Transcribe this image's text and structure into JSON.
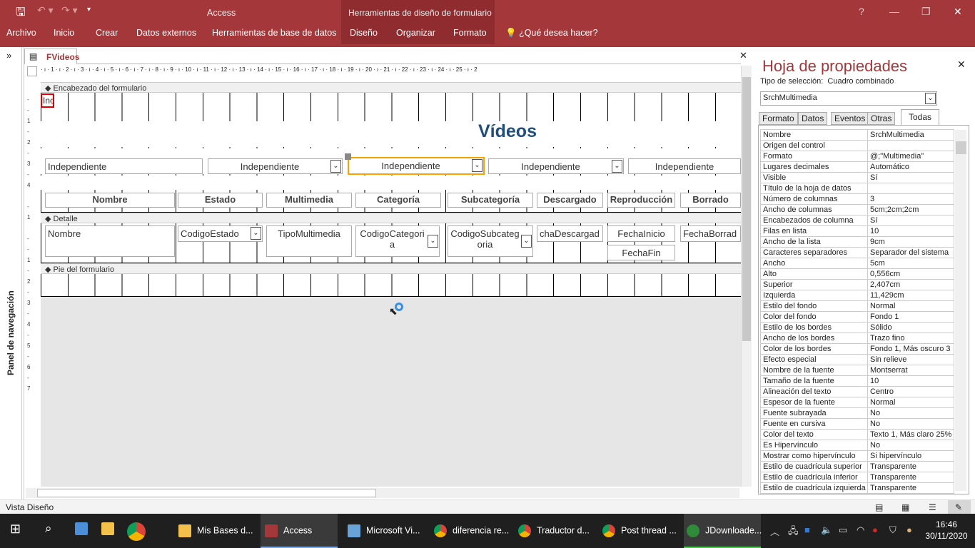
{
  "app": {
    "title": "Access",
    "context_title": "Herramientas de diseño de formulario"
  },
  "ribbon": {
    "tabs": [
      "Archivo",
      "Inicio",
      "Crear",
      "Datos externos",
      "Herramientas de base de datos",
      "Diseño",
      "Organizar",
      "Formato"
    ],
    "tell_me": "¿Qué desea hacer?"
  },
  "nav": {
    "label": "Panel de navegación",
    "expand": "»"
  },
  "document": {
    "tab": "FVideos",
    "ruler": "· ı · 1 · ı · 2 · ı · 3 · ı · 4 · ı · 5 · ı · 6 · ı · 7 · ı · 8 · ı · 9 · ı · 10 · ı · 11 · ı · 12 · ı · 13 · ı · 14 · ı · 15 · ı · 16 · ı · 17 · ı · 18 · ı · 19 · ı · 20 · ı · 21 · ı · 22 · ı · 23 · ı · 24 · ı · 25 · ı · 2"
  },
  "form": {
    "sections": {
      "header": "Encabezado del formulario",
      "detail": "Detalle",
      "footer": "Pie del formulario"
    },
    "header_small": "Inc",
    "title": "Vídeos",
    "header_controls": [
      "Independiente",
      "Independiente",
      "Independiente",
      "Independiente",
      "Independiente"
    ],
    "labels": [
      "Nombre",
      "Estado",
      "Multimedia",
      "Categoría",
      "Subcategoría",
      "Descargado",
      "Reproducción",
      "Borrado"
    ],
    "detail_controls": [
      "Nombre",
      "CodigoEstado",
      "TipoMultimedia",
      "CodigoCategoria",
      "CodigoSubcategoria",
      "chaDescargad",
      "FechaInicio",
      "FechaFin",
      "FechaBorrad"
    ]
  },
  "properties": {
    "title": "Hoja de propiedades",
    "selection_type_label": "Tipo de selección:",
    "selection_type": "Cuadro combinado",
    "object": "SrchMultimedia",
    "tabs": [
      "Formato",
      "Datos",
      "Eventos",
      "Otras",
      "Todas"
    ],
    "active_tab": "Todas",
    "rows": [
      [
        "Nombre",
        "SrchMultimedia"
      ],
      [
        "Origen del control",
        ""
      ],
      [
        "Formato",
        "@;\"Multimedia\""
      ],
      [
        "Lugares decimales",
        "Automático"
      ],
      [
        "Visible",
        "Sí"
      ],
      [
        "Título de la hoja de datos",
        ""
      ],
      [
        "Número de columnas",
        "3"
      ],
      [
        "Ancho de columnas",
        "5cm;2cm;2cm"
      ],
      [
        "Encabezados de columna",
        "Sí"
      ],
      [
        "Filas en lista",
        "10"
      ],
      [
        "Ancho de la lista",
        "9cm"
      ],
      [
        "Caracteres separadores",
        "Separador del sistema"
      ],
      [
        "Ancho",
        "5cm"
      ],
      [
        "Alto",
        "0,556cm"
      ],
      [
        "Superior",
        "2,407cm"
      ],
      [
        "Izquierda",
        "11,429cm"
      ],
      [
        "Estilo del fondo",
        "Normal"
      ],
      [
        "Color del fondo",
        "Fondo 1"
      ],
      [
        "Estilo de los bordes",
        "Sólido"
      ],
      [
        "Ancho de los bordes",
        "Trazo fino"
      ],
      [
        "Color de los bordes",
        "Fondo 1, Más oscuro 3"
      ],
      [
        "Efecto especial",
        "Sin relieve"
      ],
      [
        "Nombre de la fuente",
        "Montserrat"
      ],
      [
        "Tamaño de la fuente",
        "10"
      ],
      [
        "Alineación del texto",
        "Centro"
      ],
      [
        "Espesor de la fuente",
        "Normal"
      ],
      [
        "Fuente subrayada",
        "No"
      ],
      [
        "Fuente en cursiva",
        "No"
      ],
      [
        "Color del texto",
        "Texto 1, Más claro 25%"
      ],
      [
        "Es Hipervínculo",
        "No"
      ],
      [
        "Mostrar como hipervínculo",
        "Si hipervínculo"
      ],
      [
        "Estilo de cuadrícula superior",
        "Transparente"
      ],
      [
        "Estilo de cuadrícula inferior",
        "Transparente"
      ],
      [
        "Estilo de cuadrícula izquierda",
        "Transparente"
      ]
    ]
  },
  "status": {
    "view": "Vista Diseño"
  },
  "taskbar": {
    "items": [
      "Mis Bases d...",
      "Access",
      "Microsoft Vi...",
      "diferencia re...",
      "Traductor d...",
      "Post thread ...",
      "JDownloade..."
    ],
    "time": "16:46",
    "date": "30/11/2020"
  },
  "colors": {
    "accent": "#a4373a",
    "selection": "#f4a300"
  }
}
